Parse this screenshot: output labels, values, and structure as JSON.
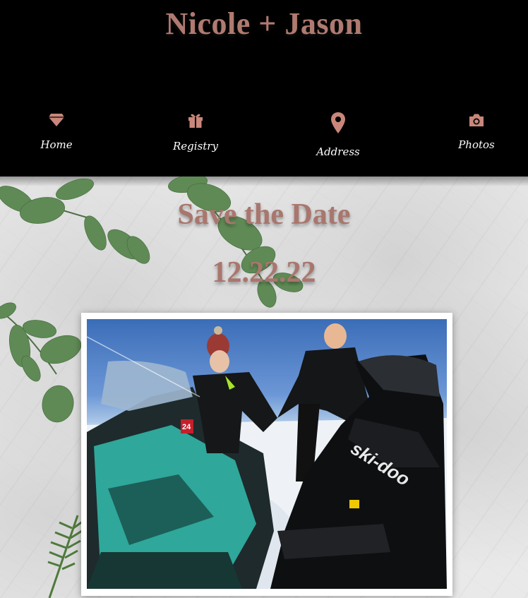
{
  "header": {
    "title": "Nicole + Jason"
  },
  "nav": {
    "items": [
      {
        "label": "Home",
        "icon": "diamond-icon"
      },
      {
        "label": "Registry",
        "icon": "gift-icon"
      },
      {
        "label": "Address",
        "icon": "map-pin-icon"
      },
      {
        "label": "Photos",
        "icon": "camera-icon"
      }
    ]
  },
  "hero": {
    "heading": "Save the Date",
    "date": "12.22.22",
    "photo_sign_number": "24",
    "photo_brand": "ski-doo"
  },
  "colors": {
    "accent": "#b07a70",
    "header_bg": "#000000",
    "nav_text": "#ffffff"
  }
}
